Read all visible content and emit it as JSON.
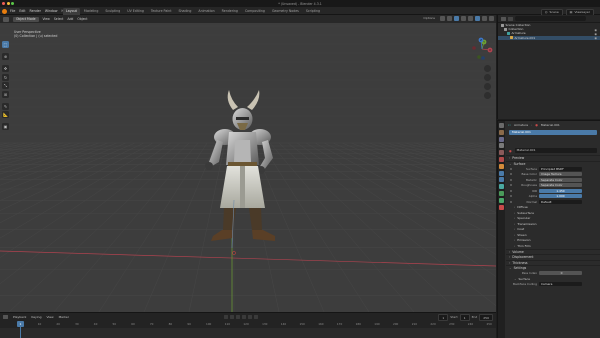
{
  "window": {
    "title": "* (Unsaved) - Blender 4.3.1"
  },
  "menu": [
    "File",
    "Edit",
    "Render",
    "Window",
    "Help"
  ],
  "workspace_tabs": [
    {
      "label": "Layout",
      "active": true
    },
    {
      "label": "Modeling",
      "active": false
    },
    {
      "label": "Sculpting",
      "active": false
    },
    {
      "label": "UV Editing",
      "active": false
    },
    {
      "label": "Texture Paint",
      "active": false
    },
    {
      "label": "Shading",
      "active": false
    },
    {
      "label": "Animation",
      "active": false
    },
    {
      "label": "Rendering",
      "active": false
    },
    {
      "label": "Compositing",
      "active": false
    },
    {
      "label": "Geometry Nodes",
      "active": false
    },
    {
      "label": "Scripting",
      "active": false
    }
  ],
  "top_right": {
    "scene": "Scene",
    "view_layer": "ViewLayer"
  },
  "viewport": {
    "mode": "Object Mode",
    "menus": [
      "View",
      "Select",
      "Add",
      "Object"
    ],
    "overlay_line1": "User Perspective",
    "overlay_line2": "(0) Collection | (u) selected",
    "header_right": "Options",
    "gizmo_axes": [
      "X",
      "Y",
      "Z"
    ]
  },
  "timeline": {
    "menus": [
      "Playback",
      "Keying",
      "View",
      "Marker"
    ],
    "current_frame": "1",
    "start_label": "Start",
    "start": "1",
    "end_label": "End",
    "end": "250",
    "ruler": [
      "0",
      "10",
      "20",
      "30",
      "40",
      "50",
      "60",
      "70",
      "80",
      "90",
      "100",
      "110",
      "120",
      "130",
      "140",
      "150",
      "160",
      "170",
      "180",
      "190",
      "200",
      "210",
      "220",
      "230",
      "240",
      "250"
    ]
  },
  "outliner": {
    "rows": [
      {
        "label": "Scene Collection",
        "color": "#9a9a9a"
      },
      {
        "label": "Collection",
        "color": "#9a9a9a"
      },
      {
        "label": "Armature",
        "color": "#3fa0a0"
      },
      {
        "label": "Armature.001",
        "color": "#d3a64a"
      }
    ]
  },
  "properties": {
    "breadcrumb_object": "Armature",
    "breadcrumb_data": "Material.001",
    "material_slot": "Material.001",
    "material_name": "Material.001",
    "preview_label": "Preview",
    "surface_label": "Surface",
    "fields": [
      {
        "label": "Surface",
        "value": "Principled BSDF",
        "style": "dark"
      },
      {
        "label": "Base Color",
        "value": "Image Texture",
        "style": "gray"
      },
      {
        "label": "Metallic",
        "value": "Separate Color",
        "style": "gray"
      },
      {
        "label": "Roughness",
        "value": "Separate Color",
        "style": "gray"
      },
      {
        "label": "IOR",
        "value": "1.450",
        "style": "blue"
      },
      {
        "label": "Alpha",
        "value": "1.000",
        "style": "blue"
      },
      {
        "label": "Normal",
        "value": "Default",
        "style": "dark"
      }
    ],
    "subsections": [
      "Diffuse",
      "Subsurface",
      "Specular",
      "Transmission",
      "Coat",
      "Sheen",
      "Emission",
      "Thin Film"
    ],
    "sections": [
      "Volume",
      "Displacement",
      "Thickness",
      "Settings"
    ],
    "pass_index_label": "Pass Index",
    "pass_index": "0",
    "surface_sub": "Surface",
    "backface_label": "Backface Culling",
    "backface_value": "Camera"
  },
  "colors": {
    "accent": "#4a7aa8",
    "blender_orange": "#e87d0d",
    "viewport_bg": "#3d3d3d",
    "x_axis": "#b0434f",
    "y_axis": "#6ea234"
  }
}
